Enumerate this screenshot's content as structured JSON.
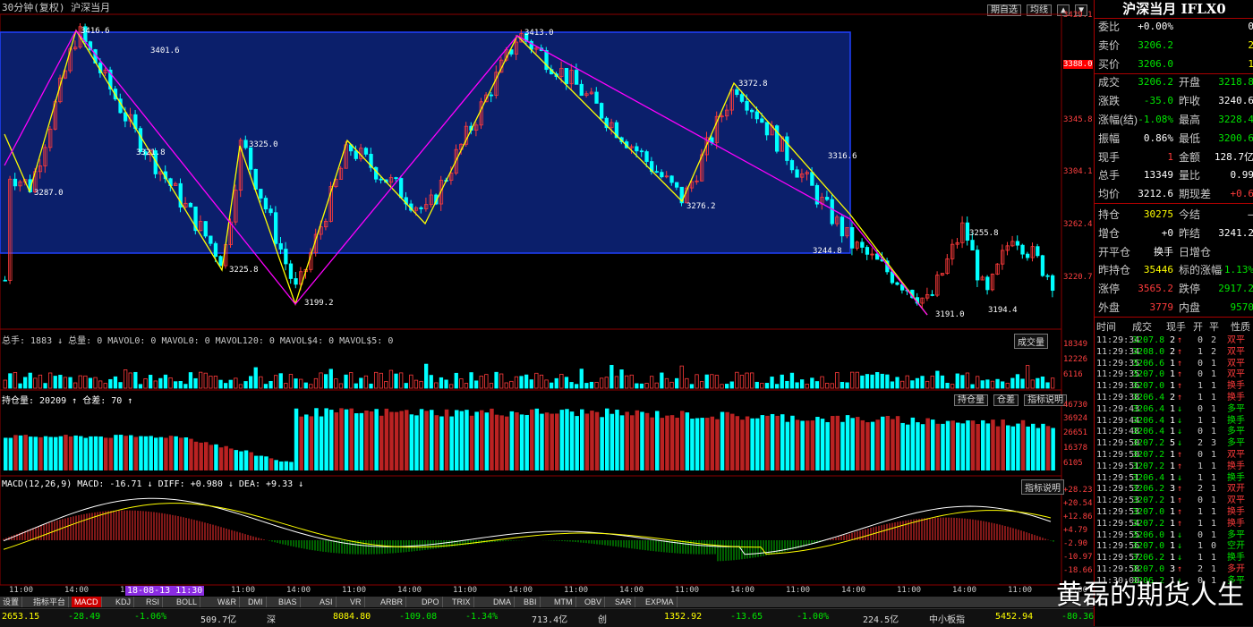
{
  "window": {
    "title": "30分钟(复权)  沪深当月",
    "top_buttons": [
      "期自选",
      "均线",
      "▲",
      "▼"
    ]
  },
  "colors": {
    "up": "#ff3b3b",
    "down": "#00ffff",
    "bg": "#000000",
    "box": "#0b1f6b",
    "yellow": "#ffff00",
    "magenta": "#ff00ff"
  },
  "price_axis": [
    "3429.1",
    "3388.0",
    "3345.8",
    "3304.1",
    "3262.4",
    "3220.7"
  ],
  "price_labels": [
    "3416.6",
    "3401.6",
    "3287.0",
    "3321.8",
    "3225.8",
    "3325.0",
    "3199.2",
    "3413.0",
    "3276.2",
    "3372.8",
    "3316.6",
    "3244.8",
    "3255.8",
    "3194.4",
    "3191.0"
  ],
  "volume": {
    "header": "总手: 1883 ↓ 总量: 0 MAVOL0: 0 MAVOL0: 0 MAVOL120: 0 MAVOL$4: 0 MAVOL$5: 0",
    "axis": [
      "18349",
      "12226",
      "6116"
    ],
    "btn": "成交量"
  },
  "oi": {
    "header": "持仓量: 20209 ↑  仓差: 70 ↑",
    "axis": [
      "46730",
      "36924",
      "26651",
      "16378",
      "6105"
    ],
    "btns": [
      "持仓量",
      "仓差",
      "指标说明"
    ]
  },
  "macd": {
    "header": "MACD(12,26,9)  MACD: -16.71 ↓  DIFF: +0.980 ↓  DEA: +9.33 ↓",
    "axis": [
      "+28.23",
      "+20.54",
      "+12.86",
      "+4.79",
      "-2.90",
      "-10.97",
      "-18.66"
    ],
    "btn": "指标说明"
  },
  "time_axis": [
    "11:00",
    "14:00",
    "11:00",
    "14:00",
    "11:00",
    "14:00",
    "11:00",
    "14:00",
    "11:00",
    "14:00",
    "11:00",
    "14:00",
    "11:00",
    "14:00",
    "11:00",
    "14:00",
    "11:00",
    "14:00",
    "11:00",
    "14:00"
  ],
  "cursor_date": "18-08-13 11:30",
  "tabs": [
    "设置",
    "指标平台",
    "MACD",
    "KDJ",
    "RSI",
    "BOLL",
    "W&R",
    "DMI",
    "BIAS",
    "ASI",
    "VR",
    "ARBR",
    "DPO",
    "TRIX",
    "DMA",
    "BBI",
    "MTM",
    "OBV",
    "SAR",
    "EXPMA"
  ],
  "quote": {
    "title": "沪深当月 IFLX0",
    "rows": [
      {
        "l": "委比",
        "v": "+0.00%",
        "vc": "white",
        "l2": "",
        "v2": "0",
        "v2c": "white"
      },
      {
        "l": "卖价",
        "v": "3206.2",
        "vc": "green",
        "l2": "",
        "v2": "2",
        "v2c": "yellow"
      },
      {
        "l": "买价",
        "v": "3206.0",
        "vc": "green",
        "l2": "",
        "v2": "1",
        "v2c": "yellow"
      },
      {
        "l": "成交",
        "v": "3206.2",
        "vc": "green",
        "l2": "开盘",
        "v2": "3218.8",
        "v2c": "green"
      },
      {
        "l": "涨跌",
        "v": "-35.0",
        "vc": "green",
        "l2": "昨收",
        "v2": "3240.6",
        "v2c": "white"
      },
      {
        "l": "涨幅(结)",
        "v": "-1.08%",
        "vc": "green",
        "l2": "最高",
        "v2": "3228.4",
        "v2c": "green"
      },
      {
        "l": "振幅",
        "v": "0.86%",
        "vc": "white",
        "l2": "最低",
        "v2": "3200.6",
        "v2c": "green"
      },
      {
        "l": "现手",
        "v": "1",
        "vc": "red",
        "l2": "金额",
        "v2": "128.7亿",
        "v2c": "white"
      },
      {
        "l": "总手",
        "v": "13349",
        "vc": "white",
        "l2": "量比",
        "v2": "0.99",
        "v2c": "white"
      },
      {
        "l": "均价",
        "v": "3212.6",
        "vc": "white",
        "l2": "期现差",
        "v2": "+0.6",
        "v2c": "red"
      },
      {
        "l": "持仓",
        "v": "30275",
        "vc": "yellow",
        "l2": "今结",
        "v2": "—",
        "v2c": "white"
      },
      {
        "l": "增仓",
        "v": "+0",
        "vc": "white",
        "l2": "昨结",
        "v2": "3241.2",
        "v2c": "white"
      },
      {
        "l": "开平仓",
        "v": "换手",
        "vc": "white",
        "l2": "日增仓",
        "v2": "",
        "v2c": "white"
      },
      {
        "l": "昨持仓",
        "v": "35446",
        "vc": "yellow",
        "l2": "标的涨幅",
        "v2": "-1.13%",
        "v2c": "green"
      },
      {
        "l": "涨停",
        "v": "3565.2",
        "vc": "red",
        "l2": "跌停",
        "v2": "2917.2",
        "v2c": "green"
      },
      {
        "l": "外盘",
        "v": "3779",
        "vc": "red",
        "l2": "内盘",
        "v2": "9570",
        "v2c": "green"
      }
    ],
    "trade_header": [
      "时间",
      "成交",
      "现手",
      "开",
      "平",
      "性质"
    ],
    "trades": [
      [
        "11:29:34",
        "3207.8",
        "2",
        "↑",
        "0",
        "2",
        "双平",
        "red"
      ],
      [
        "11:29:34",
        "3208.0",
        "2",
        "↑",
        "1",
        "2",
        "双平",
        "red"
      ],
      [
        "11:29:35",
        "3206.6",
        "1",
        "↑",
        "0",
        "1",
        "双平",
        "red"
      ],
      [
        "11:29:35",
        "3207.0",
        "1",
        "↑",
        "0",
        "1",
        "双平",
        "red"
      ],
      [
        "11:29:36",
        "3207.0",
        "1",
        "↑",
        "1",
        "1",
        "换手",
        "red"
      ],
      [
        "11:29:38",
        "3206.4",
        "2",
        "↑",
        "1",
        "1",
        "换手",
        "red"
      ],
      [
        "11:29:43",
        "3206.4",
        "1",
        "↓",
        "0",
        "1",
        "多平",
        "green"
      ],
      [
        "11:29:44",
        "3206.4",
        "1",
        "↓",
        "1",
        "1",
        "换手",
        "green"
      ],
      [
        "11:29:48",
        "3206.4",
        "1",
        "↓",
        "0",
        "1",
        "多平",
        "green"
      ],
      [
        "11:29:50",
        "3207.2",
        "5",
        "↓",
        "2",
        "3",
        "多平",
        "green"
      ],
      [
        "11:29:50",
        "3207.2",
        "1",
        "↑",
        "0",
        "1",
        "双平",
        "red"
      ],
      [
        "11:29:51",
        "3207.2",
        "1",
        "↑",
        "1",
        "1",
        "换手",
        "red"
      ],
      [
        "11:29:51",
        "3206.4",
        "1",
        "↓",
        "1",
        "1",
        "换手",
        "green"
      ],
      [
        "11:29:52",
        "3206.2",
        "3",
        "↑",
        "2",
        "1",
        "双开",
        "red"
      ],
      [
        "11:29:53",
        "3207.2",
        "1",
        "↑",
        "0",
        "1",
        "双平",
        "red"
      ],
      [
        "11:29:53",
        "3207.0",
        "1",
        "↑",
        "1",
        "1",
        "换手",
        "red"
      ],
      [
        "11:29:54",
        "3207.2",
        "1",
        "↑",
        "1",
        "1",
        "换手",
        "red"
      ],
      [
        "11:29:55",
        "3206.0",
        "1",
        "↓",
        "0",
        "1",
        "多平",
        "green"
      ],
      [
        "11:29:56",
        "3207.0",
        "1",
        "↓",
        "1",
        "0",
        "空开",
        "green"
      ],
      [
        "11:29:57",
        "3206.2",
        "1",
        "↓",
        "1",
        "1",
        "换手",
        "green"
      ],
      [
        "11:29:58",
        "3207.0",
        "3",
        "↑",
        "2",
        "1",
        "多开",
        "red"
      ],
      [
        "11:30:00",
        "3206.2",
        "1",
        "↓",
        "0",
        "1",
        "多平",
        "green"
      ]
    ]
  },
  "status": {
    "items": [
      "2653.15",
      "-28.49",
      "-1.06%",
      "509.7亿",
      "深",
      "8084.80",
      "-109.08",
      "-1.34%",
      "713.4亿",
      "创",
      "1352.92",
      "-13.65",
      "-1.00%",
      "224.5亿",
      "中小板指",
      "5452.94",
      "-80.36",
      "-1.45%",
      "288.0亿"
    ]
  },
  "watermark": "黄磊的期货人生"
}
